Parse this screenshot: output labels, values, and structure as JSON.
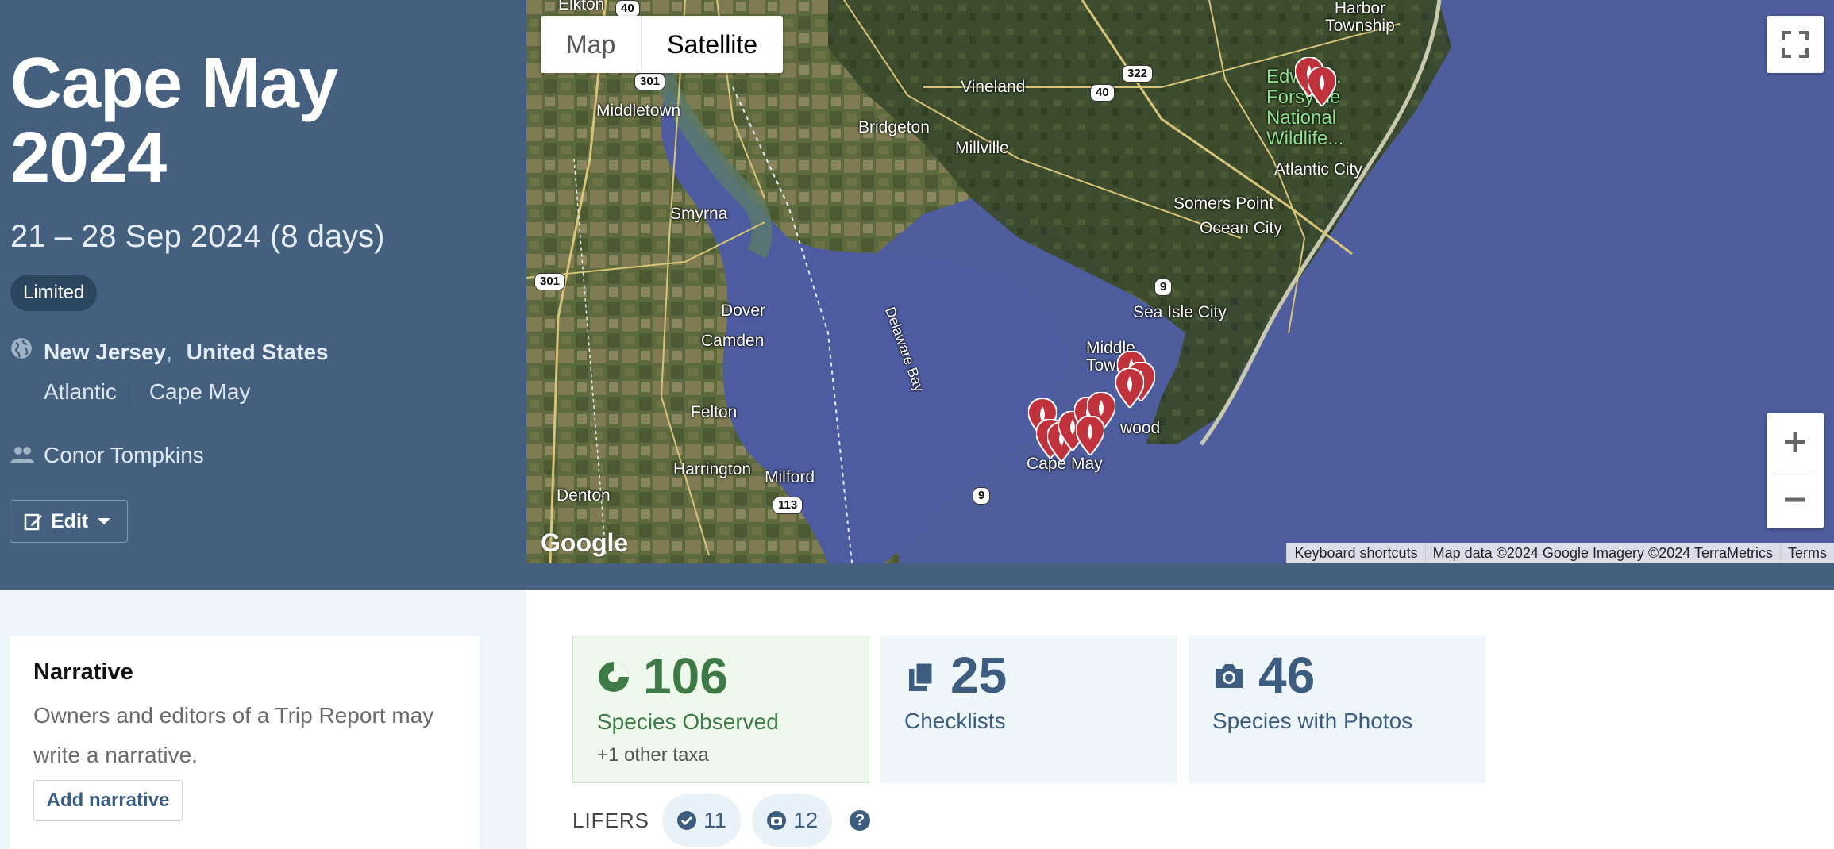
{
  "trip": {
    "title": "Cape May 2024",
    "dates": "21 – 28 Sep 2024 (8 days)",
    "visibility": "Limited",
    "state": "New Jersey",
    "country": "United States",
    "regions": [
      "Atlantic",
      "Cape May"
    ],
    "participant": "Conor Tompkins",
    "edit_label": "Edit"
  },
  "map": {
    "type_buttons": [
      "Map",
      "Satellite"
    ],
    "selected_type": "Satellite",
    "labels": [
      "Elkton",
      "Harbor Township",
      "Middletown",
      "Vineland",
      "Bridgeton",
      "Millville",
      "Edwin B. Forsythe National Wildlife...",
      "Atlantic City",
      "Somers Point",
      "Ocean City",
      "Smyrna",
      "Sea Isle City",
      "Dover",
      "Camden",
      "Delaware Bay",
      "Middle Town",
      "Felton",
      "wood",
      "Harrington",
      "Milford",
      "Cape May",
      "Denton"
    ],
    "shields": [
      "40",
      "301",
      "40",
      "322",
      "301",
      "9",
      "113",
      "9"
    ],
    "attribution": [
      "Keyboard shortcuts",
      "Map data ©2024 Google Imagery ©2024 TerraMetrics",
      "Terms"
    ],
    "logo": "Google"
  },
  "narrative": {
    "title": "Narrative",
    "text": "Owners and editors of a Trip Report may write a narrative.",
    "button": "Add narrative"
  },
  "stats": {
    "species": {
      "value": "106",
      "label": "Species Observed",
      "sub": "+1 other taxa"
    },
    "checklists": {
      "value": "25",
      "label": "Checklists"
    },
    "photos": {
      "value": "46",
      "label": "Species with Photos"
    }
  },
  "lifers": {
    "title": "LIFERS",
    "checked": "11",
    "photo": "12"
  },
  "colors": {
    "header_bg": "#44607e",
    "species_green": "#3e7a45",
    "accent_blue": "#3d5d80",
    "pin_red": "#c0333d"
  }
}
